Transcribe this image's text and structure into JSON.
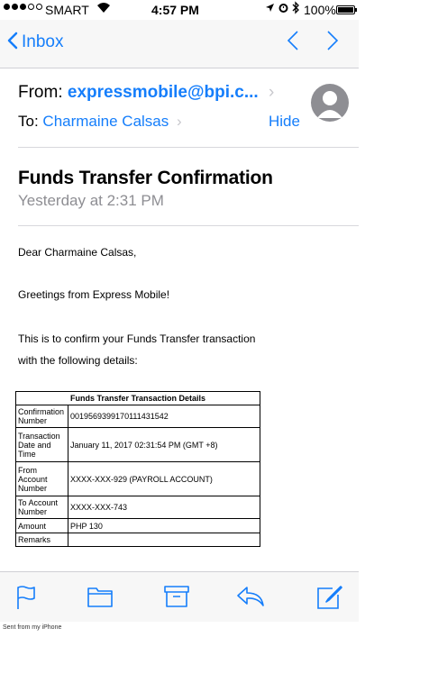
{
  "status_bar": {
    "carrier": "SMART",
    "time": "4:57 PM",
    "battery_percent": "100%",
    "battery_level": 1.0,
    "signal_bars_filled": 3,
    "signal_bars_total": 5,
    "icons": [
      "wifi-icon",
      "location-arrow-icon",
      "alarm-icon",
      "bluetooth-icon",
      "battery-icon"
    ]
  },
  "nav": {
    "back_label": "Inbox",
    "up_glyph": "‹",
    "down_glyph": "›"
  },
  "header": {
    "from_label": "From:",
    "from_address": "expressmobile@bpi.c...",
    "to_label": "To:",
    "to_name": "Charmaine Calsas",
    "hide_label": "Hide",
    "subject": "Funds Transfer Confirmation",
    "date": "Yesterday at 2:31 PM"
  },
  "body": {
    "greeting": "Dear Charmaine Calsas,",
    "line2": "Greetings from Express Mobile!",
    "line3": "This is to confirm your Funds Transfer transaction",
    "line4": "with the following details:"
  },
  "details_table": {
    "title": "Funds Transfer Transaction Details",
    "rows": [
      {
        "label": "Confirmation Number",
        "value": "0019569399170111431542"
      },
      {
        "label": "Transaction Date and Time",
        "value": "January 11, 2017 02:31:54 PM (GMT +8)"
      },
      {
        "label": "From Account Number",
        "value": "XXXX-XXX-929 (PAYROLL ACCOUNT)"
      },
      {
        "label": "To Account Number",
        "value": "XXXX-XXX-743"
      },
      {
        "label": "Amount",
        "value": "PHP 130"
      },
      {
        "label": "Remarks",
        "value": ""
      }
    ]
  },
  "toolbar": {
    "items": [
      "flag-icon",
      "folder-icon",
      "archive-icon",
      "reply-icon",
      "compose-icon"
    ]
  },
  "footer": {
    "sent_from": "Sent from my iPhone"
  },
  "colors": {
    "accent": "#157efb",
    "secondary_text": "#8e8e93",
    "bar_background": "#f7f7f7"
  }
}
